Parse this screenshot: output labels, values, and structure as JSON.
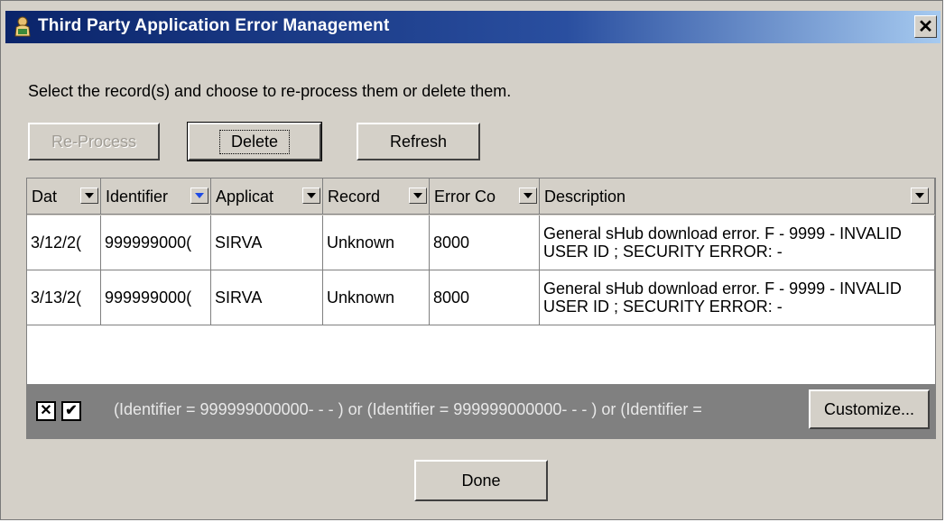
{
  "window": {
    "title": "Third Party Application Error Management",
    "close_glyph": "✕"
  },
  "instruction": "Select the record(s) and choose to re-process them or delete them.",
  "toolbar": {
    "reprocess_label": "Re-Process",
    "delete_label": "Delete",
    "refresh_label": "Refresh"
  },
  "grid": {
    "columns": [
      "Dat",
      "Identifier",
      "Applicat",
      "Record",
      "Error Co",
      "Description"
    ],
    "rows": [
      {
        "date": "3/12/2(",
        "identifier": "999999000(",
        "application": "SIRVA",
        "record": "Unknown",
        "error_code": "8000",
        "description": "General sHub download error. F - 9999 - INVALID USER ID ; SECURITY ERROR: -"
      },
      {
        "date": "3/13/2(",
        "identifier": "999999000(",
        "application": "SIRVA",
        "record": "Unknown",
        "error_code": "8000",
        "description": "General sHub download error. F - 9999 - INVALID USER ID ; SECURITY ERROR: -"
      }
    ]
  },
  "filter": {
    "clear_glyph": "✕",
    "enabled_glyph": "✔",
    "text": "(Identifier = 999999000000- - - ) or (Identifier = 999999000000- - - ) or (Identifier =",
    "customize_label": "Customize..."
  },
  "footer": {
    "done_label": "Done"
  }
}
